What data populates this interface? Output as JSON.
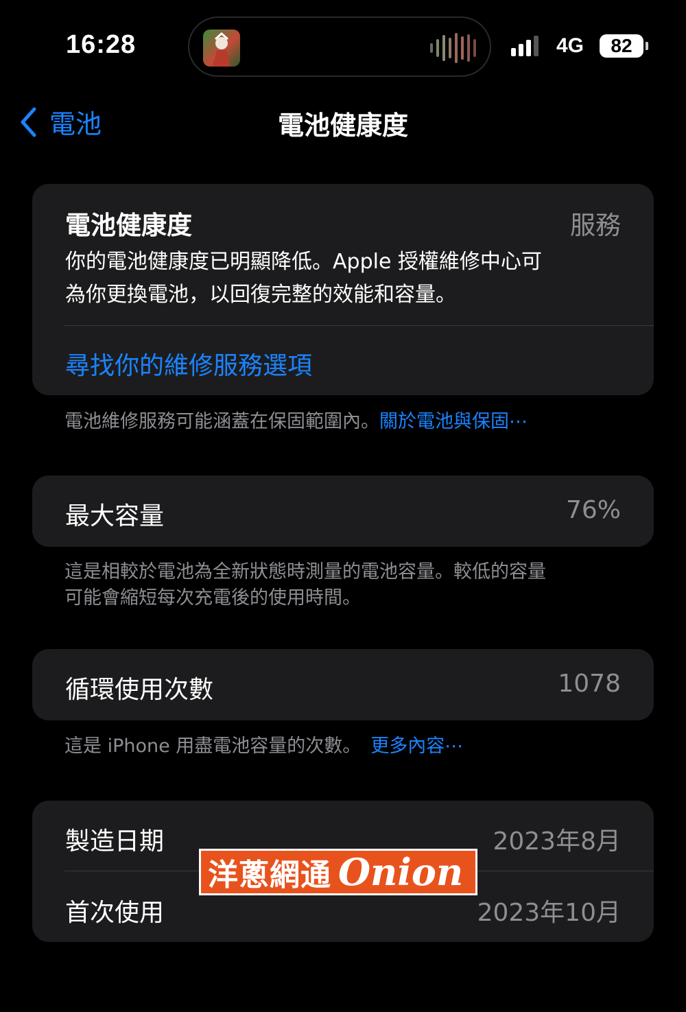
{
  "status_bar": {
    "time": "16:28",
    "network": "4G",
    "battery_level": "82",
    "signal_bars": 3,
    "icons": [
      "album-art-icon",
      "audio-waveform-icon",
      "signal-bars-icon",
      "battery-icon"
    ]
  },
  "nav": {
    "back_label": "電池",
    "title": "電池健康度"
  },
  "health_card": {
    "title": "電池健康度",
    "status": "服務",
    "description_line1": "你的電池健康度已明顯降低。Apple 授權維修中心可",
    "description_line2": "為你更換電池，以回復完整的效能和容量。",
    "link": "尋找你的維修服務選項"
  },
  "health_footer": {
    "text": "電池維修服務可能涵蓋在保固範圍內。",
    "link": "關於電池與保固⋯"
  },
  "max_capacity": {
    "label": "最大容量",
    "value": "76%"
  },
  "capacity_footer": {
    "line1": "這是相較於電池為全新狀態時測量的電池容量。較低的容量",
    "line2": "可能會縮短每次充電後的使用時間。"
  },
  "cycle_count": {
    "label": "循環使用次數",
    "value": "1078"
  },
  "cycle_footer": {
    "text": "這是 iPhone 用盡電池容量的次數。",
    "link": "更多內容⋯"
  },
  "dates": {
    "manufacture_label": "製造日期",
    "manufacture_value": "2023年8月",
    "first_use_label": "首次使用",
    "first_use_value": "2023年10月"
  },
  "watermark": {
    "chinese": "洋蔥網通",
    "english": "Onion"
  },
  "colors": {
    "background": "#000000",
    "card": "#1c1c1e",
    "accent": "#1a84ff",
    "secondary_text": "#8e8e93",
    "watermark": "#e8531d"
  }
}
